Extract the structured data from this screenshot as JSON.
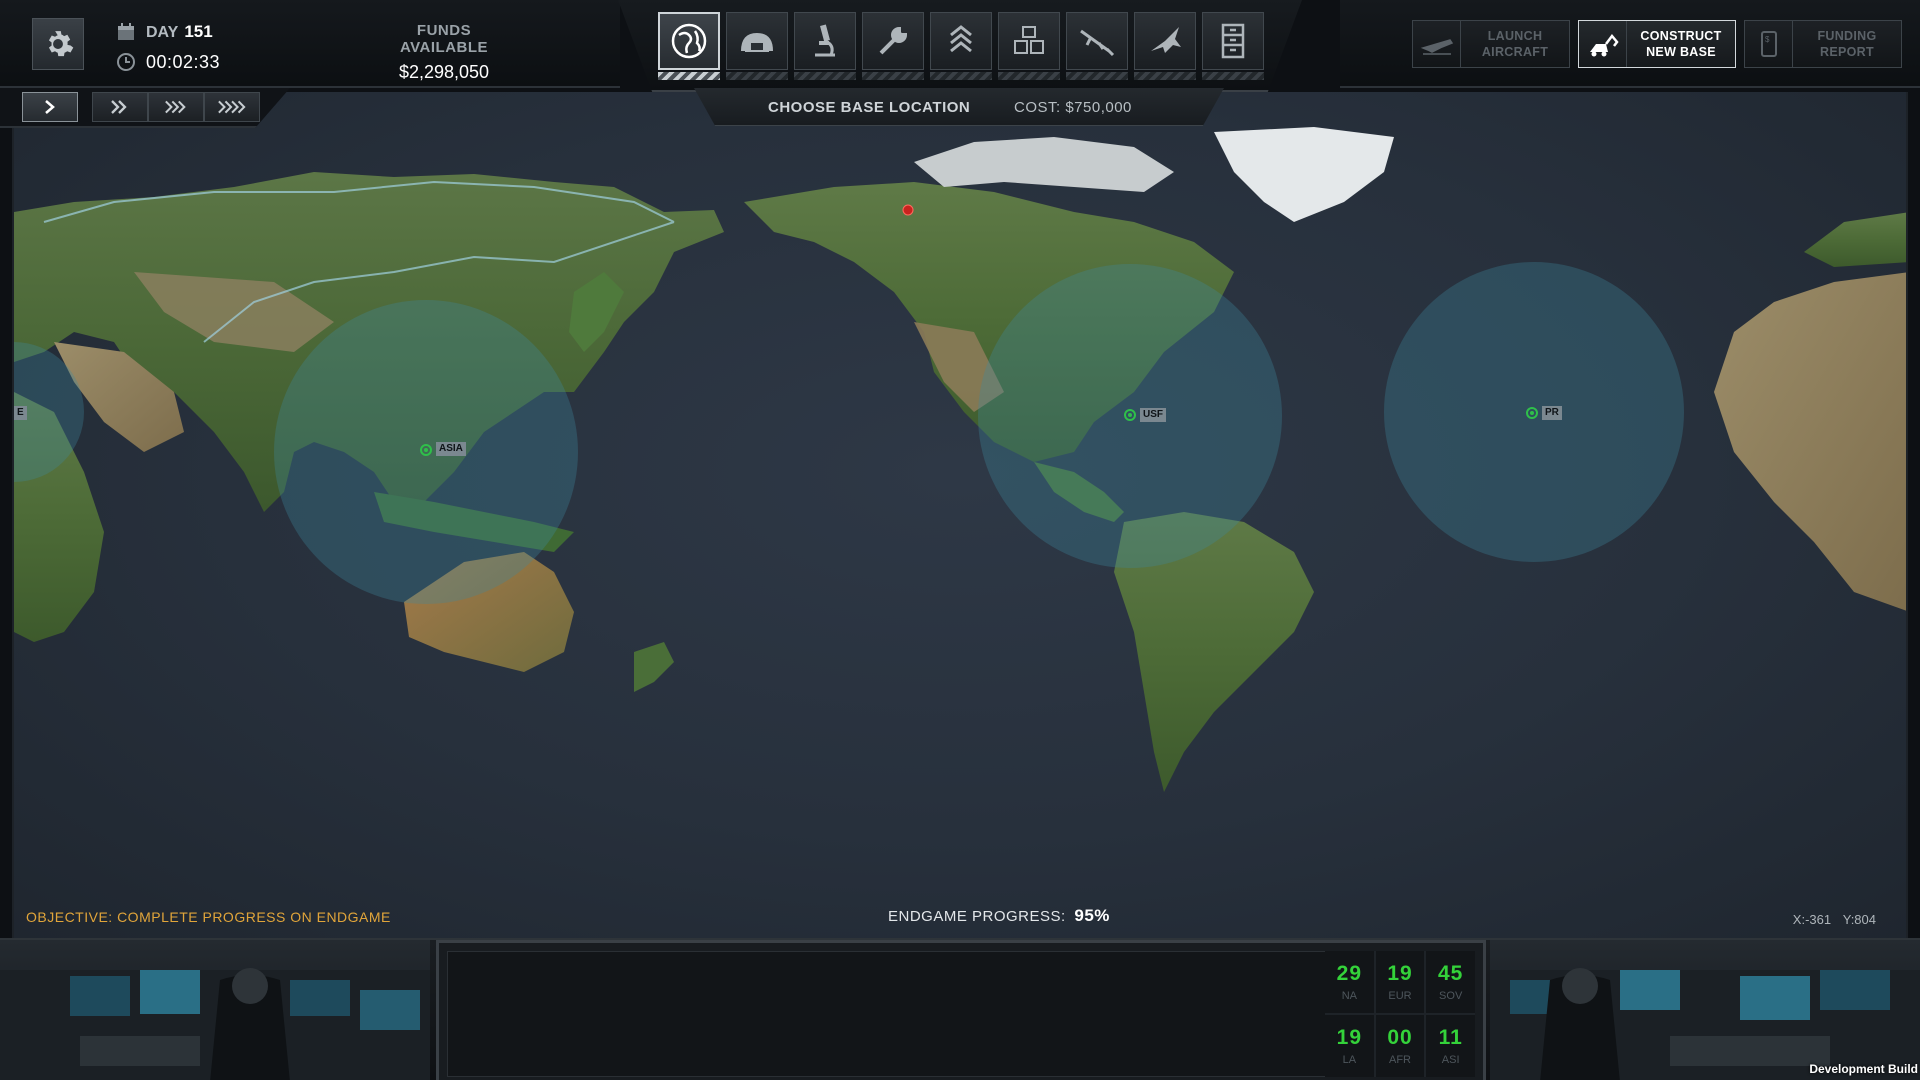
{
  "header": {
    "day_label": "DAY",
    "day_value": "151",
    "clock": "00:02:33",
    "funds_label": "FUNDS AVAILABLE",
    "funds_value": "$2,298,050"
  },
  "speed_controls": [
    "speed-1",
    "speed-2",
    "speed-3",
    "speed-4"
  ],
  "nav": {
    "buttons": [
      "geoscape-globe",
      "base-hangar",
      "research-microscope",
      "engineering-wrench",
      "soldiers-rank",
      "storage-crates",
      "weapons-rifle",
      "aircraft-jet",
      "records-cabinet"
    ],
    "active": "geoscape-globe"
  },
  "subbar": {
    "title": "CHOOSE BASE LOCATION",
    "cost": "COST: $750,000"
  },
  "right_buttons": {
    "launch_aircraft": "LAUNCH\nAIRCRAFT",
    "construct_new_base": "CONSTRUCT\nNEW BASE",
    "funding_report": "FUNDING\nREPORT"
  },
  "map": {
    "objective": "OBJECTIVE: COMPLETE PROGRESS ON ENDGAME",
    "endgame_label": "ENDGAME PROGRESS:",
    "endgame_value": "95%",
    "endgame_progress_percent": 95,
    "coord_x": "X:-361",
    "coord_y": "Y:804",
    "bases": [
      {
        "label": "ASIA",
        "color": "#2fbf4a"
      },
      {
        "label": "USF",
        "color": "#2fbf4a"
      },
      {
        "label": "PR",
        "color": "#2fbf4a"
      },
      {
        "label": "E",
        "color": "#2fbf4a"
      }
    ],
    "ufo_marker_color": "#c8231f",
    "coverage_color": "#3f8aa0"
  },
  "panic": [
    {
      "value": "29",
      "region": "NA"
    },
    {
      "value": "19",
      "region": "EUR"
    },
    {
      "value": "45",
      "region": "SOV"
    },
    {
      "value": "19",
      "region": "LA"
    },
    {
      "value": "00",
      "region": "AFR"
    },
    {
      "value": "11",
      "region": "ASI"
    }
  ],
  "panic_color": "#34d23a",
  "footer": {
    "dev_build": "Development Build"
  }
}
